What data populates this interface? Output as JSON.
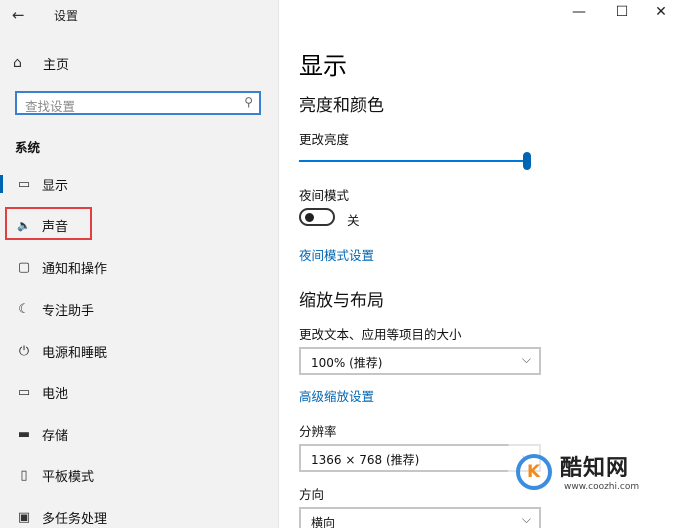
{
  "titlebar": {
    "title": "设置",
    "back_glyph": "←",
    "minimize_glyph": "—",
    "maximize_glyph": "☐",
    "close_glyph": "✕"
  },
  "sidebar": {
    "home": {
      "icon": "home-icon",
      "glyph": "⌂",
      "label": "主页"
    },
    "search": {
      "placeholder": "查找设置",
      "icon": "search-icon",
      "glyph": "⚲"
    },
    "section_title": "系统",
    "items": [
      {
        "name": "display",
        "icon": "monitor-icon",
        "glyph": "▭",
        "label": "显示",
        "selected": true
      },
      {
        "name": "sound",
        "icon": "speaker-icon",
        "glyph": "🔈",
        "label": "声音",
        "highlighted": true
      },
      {
        "name": "notifications",
        "icon": "message-icon",
        "glyph": "▢",
        "label": "通知和操作"
      },
      {
        "name": "focus",
        "icon": "moon-icon",
        "glyph": "☾",
        "label": "专注助手"
      },
      {
        "name": "power",
        "icon": "power-icon",
        "glyph": "⏻",
        "label": "电源和睡眠"
      },
      {
        "name": "battery",
        "icon": "battery-icon",
        "glyph": "▭",
        "label": "电池"
      },
      {
        "name": "storage",
        "icon": "storage-icon",
        "glyph": "▬",
        "label": "存储"
      },
      {
        "name": "tablet",
        "icon": "tablet-icon",
        "glyph": "▯",
        "label": "平板模式"
      },
      {
        "name": "multitasking",
        "icon": "multitask-icon",
        "glyph": "▣",
        "label": "多任务处理"
      }
    ]
  },
  "main": {
    "page_title": "显示",
    "brightness_section": "亮度和颜色",
    "brightness_label": "更改亮度",
    "brightness_value": 1.0,
    "night_mode_label": "夜间模式",
    "night_mode_state": "关",
    "night_mode_link": "夜间模式设置",
    "scale_section": "缩放与布局",
    "scale_label": "更改文本、应用等项目的大小",
    "scale_value": "100% (推荐)",
    "advanced_scale_link": "高级缩放设置",
    "resolution_label": "分辨率",
    "resolution_value": "1366 × 768 (推荐)",
    "orientation_label": "方向",
    "orientation_value": "横向",
    "chevron_glyph": "⌵"
  },
  "watermark": {
    "logo_letter": "K",
    "name": "酷知网",
    "url": "www.coozhi.com"
  },
  "colors": {
    "accent": "#0078d7",
    "link": "#0066b4",
    "highlight_border": "#e24040",
    "sidebar_bg": "#f2f2f2"
  }
}
